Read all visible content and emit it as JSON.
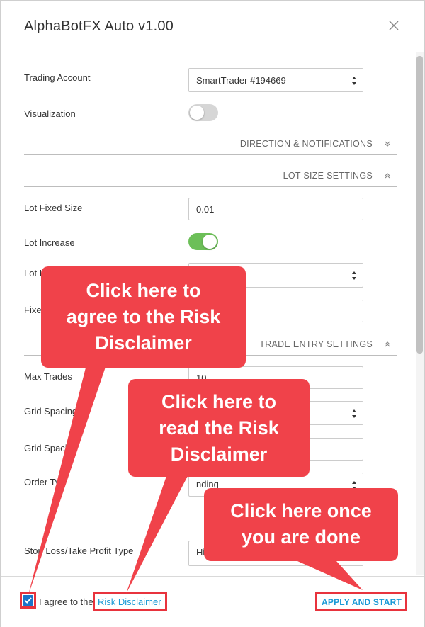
{
  "window": {
    "title": "AlphaBotFX Auto v1.00",
    "close_icon": "close-icon"
  },
  "form": {
    "trading_account": {
      "label": "Trading Account",
      "value": "SmartTrader #194669"
    },
    "visualization": {
      "label": "Visualization",
      "on": false
    },
    "sections": {
      "direction": "DIRECTION & NOTIFICATIONS",
      "lot_size": "LOT SIZE SETTINGS",
      "trade_entry": "TRADE ENTRY SETTINGS"
    },
    "lot_fixed_size": {
      "label": "Lot Fixed Size",
      "value": "0.01"
    },
    "lot_increase": {
      "label": "Lot Increase",
      "on": true
    },
    "lot_increase_type": {
      "label": "Lot I",
      "value": ""
    },
    "fixed": {
      "label": "Fixe",
      "value": ""
    },
    "max_trades": {
      "label": "Max Trades",
      "value": "10"
    },
    "grid_spacing": {
      "label": "Grid Spacing",
      "value": ""
    },
    "grid_spacing_2": {
      "label": "Grid Spaci",
      "value": ""
    },
    "order_type": {
      "label": "Order Ty",
      "value": "nding"
    },
    "sl_tp_type": {
      "label": "Stop Loss/Take Profit Type",
      "value": "Hi"
    }
  },
  "footer": {
    "agree_text": "I agree to the",
    "risk_link": "Risk Disclaimer",
    "apply_label": "APPLY AND START",
    "agreed": true
  },
  "callouts": {
    "agree": "Click here to\nagree to the Risk\nDisclaimer",
    "read": "Click here to\nread the Risk\nDisclaimer",
    "done": "Click here once\nyou are done"
  },
  "colors": {
    "callout": "#f0424a",
    "link": "#1a9ad6",
    "toggle_on": "#6cbf58",
    "toggle_off": "#d6d6d6",
    "checkbox": "#1a73c9"
  }
}
